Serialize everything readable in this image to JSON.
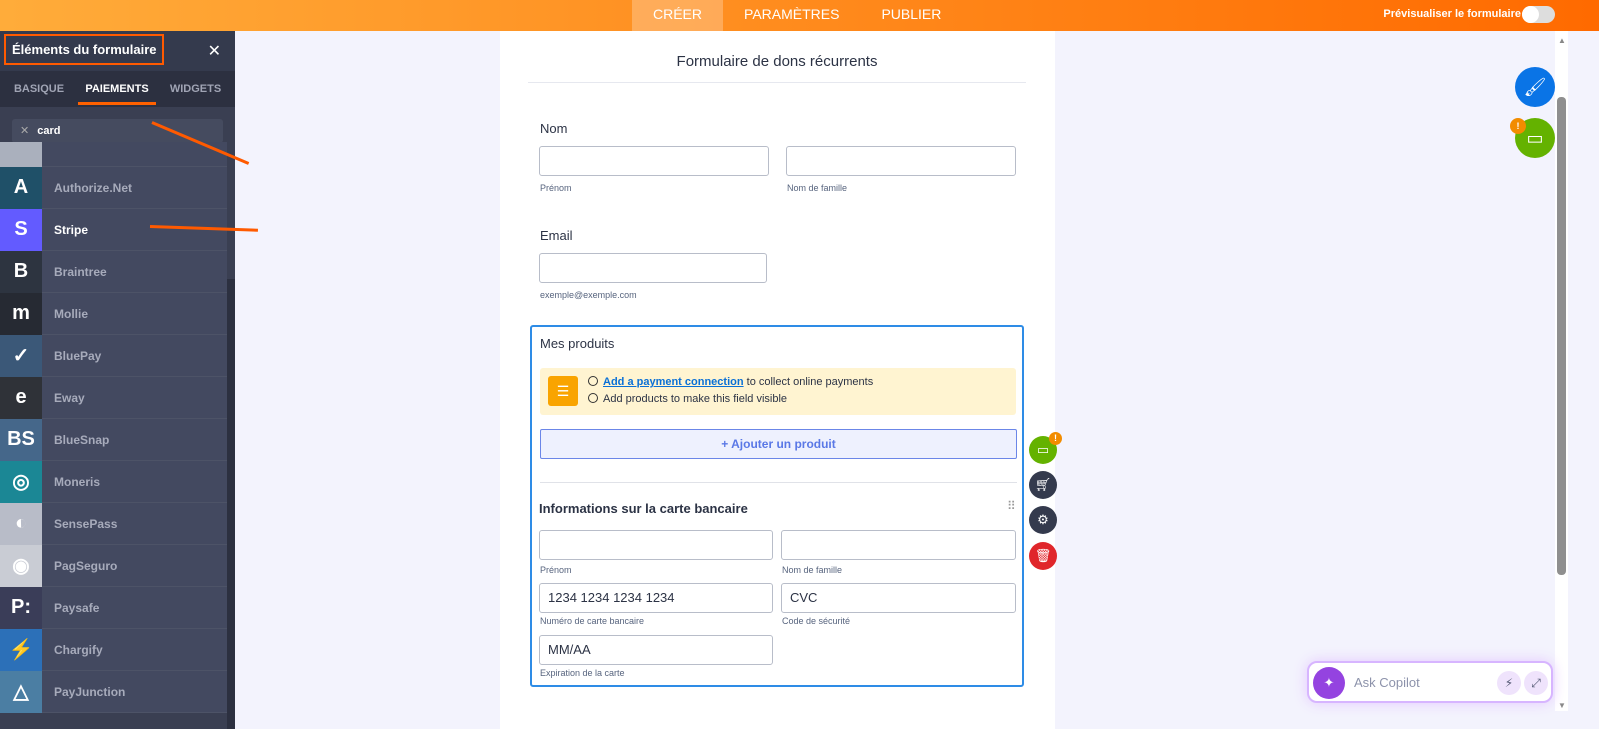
{
  "topbar": {
    "tabs": [
      "CRÉER",
      "PARAMÈTRES",
      "PUBLIER"
    ],
    "preview_label": "Prévisualiser le formulaire"
  },
  "sidebar": {
    "title": "Éléments du formulaire",
    "tabs": [
      "BASIQUE",
      "PAIEMENTS",
      "WIDGETS"
    ],
    "search_value": "card",
    "items": [
      {
        "label": "Authorize.Net",
        "glyph": "A",
        "color": "#1f5068"
      },
      {
        "label": "Stripe",
        "glyph": "S",
        "color": "#635bff"
      },
      {
        "label": "Braintree",
        "glyph": "B",
        "color": "#2d3440"
      },
      {
        "label": "Mollie",
        "glyph": "m",
        "color": "#262a33"
      },
      {
        "label": "BluePay",
        "glyph": "✓",
        "color": "#3b5878"
      },
      {
        "label": "Eway",
        "glyph": "e",
        "color": "#2f3238"
      },
      {
        "label": "BlueSnap",
        "glyph": "BS",
        "color": "#45678a"
      },
      {
        "label": "Moneris",
        "glyph": "◎",
        "color": "#1b8795"
      },
      {
        "label": "SensePass",
        "glyph": "◐",
        "color": "#b8bcc8"
      },
      {
        "label": "PagSeguro",
        "glyph": "◉",
        "color": "#c9ccd4"
      },
      {
        "label": "Paysafe",
        "glyph": "P:",
        "color": "#3a3d58"
      },
      {
        "label": "Chargify",
        "glyph": "⚡",
        "color": "#2c70b8"
      },
      {
        "label": "PayJunction",
        "glyph": "△",
        "color": "#4b7ea3"
      }
    ]
  },
  "form": {
    "title": "Formulaire de dons récurrents",
    "name_label": "Nom",
    "first_sub": "Prénom",
    "last_sub": "Nom de famille",
    "email_label": "Email",
    "email_sub": "exemple@exemple.com",
    "products_label": "Mes produits",
    "warn_link": "Add a payment connection",
    "warn_text1": " to collect online payments",
    "warn_text2": "Add products to make this field visible",
    "add_product": "+ Ajouter un produit",
    "card_title": "Informations sur la carte bancaire",
    "card_first_sub": "Prénom",
    "card_last_sub": "Nom de famille",
    "card_number_placeholder": "1234 1234 1234 1234",
    "card_number_sub": "Numéro de carte bancaire",
    "cvc_placeholder": "CVC",
    "cvc_sub": "Code de sécurité",
    "exp_placeholder": "MM/AA",
    "exp_sub": "Expiration de la carte"
  },
  "badges": {
    "warning": "!"
  },
  "copilot": {
    "placeholder": "Ask Copilot"
  }
}
